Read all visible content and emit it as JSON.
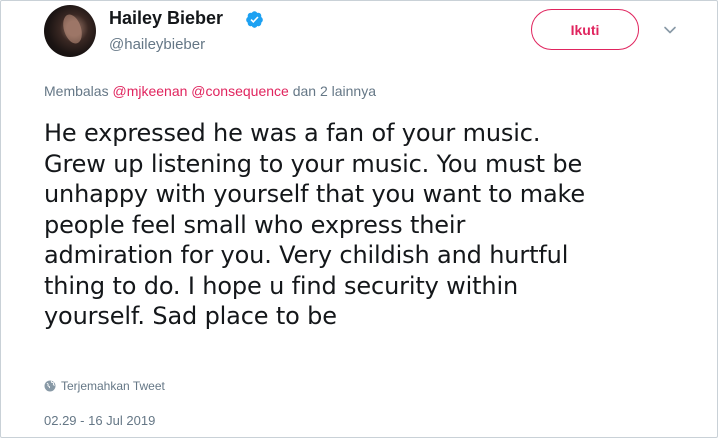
{
  "user": {
    "display_name": "Hailey Bieber",
    "handle": "@haileybieber",
    "verified": true
  },
  "follow_button": {
    "label": "Ikuti"
  },
  "colors": {
    "accent": "#e0245e",
    "verified": "#1da1f2",
    "secondary_text": "#657786",
    "primary_text": "#14171a"
  },
  "reply_line": {
    "prefix": "Membalas",
    "mentions": [
      "@mjkeenan",
      "@consequence"
    ],
    "suffix": "dan 2 lainnya"
  },
  "tweet": {
    "lines": [
      "He expressed he was a fan of your music.",
      "Grew up listening to your music. You must be",
      "unhappy with yourself that you want to make",
      "people feel small who express their",
      "admiration for you. Very childish and hurtful",
      "thing to do. I hope u find security within",
      "yourself. Sad place to be"
    ]
  },
  "translate_link": {
    "label": "Terjemahkan Tweet",
    "icon": "globe-icon"
  },
  "timestamp": "02.29 - 16 Jul 2019"
}
